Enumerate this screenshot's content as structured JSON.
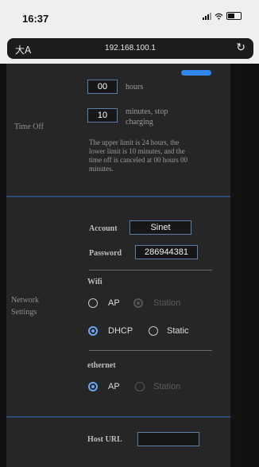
{
  "status_bar": {
    "time": "16:37",
    "signal_icon": "signal-icon",
    "wifi_icon": "wifi-icon",
    "battery_icon": "battery-icon"
  },
  "browser": {
    "url": "192.168.100.1",
    "text_settings_icon": "aa-icon",
    "text_settings_glyph": "大A",
    "reload_icon": "reload-icon",
    "reload_glyph": "↻"
  },
  "time_off": {
    "label": "Time Off",
    "hours_value": "00",
    "hours_unit": "hours",
    "minutes_value": "10",
    "minutes_unit_line1": "minutes, stop",
    "minutes_unit_line2": "charging",
    "note_lines": [
      "The upper limit is 24 hours, the",
      "lower limit is 10 minutes, and the",
      "time off is canceled at 00 hours 00",
      "minutes."
    ]
  },
  "network": {
    "label_line1": "Network",
    "label_line2": "Settings",
    "account_label": "Account",
    "account_value": "Sinet",
    "password_label": "Password",
    "password_value": "286944381",
    "wifi_title": "Wifi",
    "wifi_mode": [
      {
        "label": "AP",
        "selected": false,
        "disabled": false
      },
      {
        "label": "Station",
        "selected": true,
        "disabled": true
      }
    ],
    "ip_mode": [
      {
        "label": "DHCP",
        "selected": true,
        "disabled": false
      },
      {
        "label": "Static",
        "selected": false,
        "disabled": false
      }
    ],
    "ethernet_title": "ethernet",
    "ethernet_mode": [
      {
        "label": "AP",
        "selected": true,
        "disabled": false
      },
      {
        "label": "Station",
        "selected": false,
        "disabled": true
      }
    ]
  },
  "host": {
    "label": "Host URL",
    "value": ""
  },
  "colors": {
    "accent": "#6aa6f5",
    "separator": "#2a4e78",
    "panel": "#262626",
    "pill": "#2f86ee"
  }
}
